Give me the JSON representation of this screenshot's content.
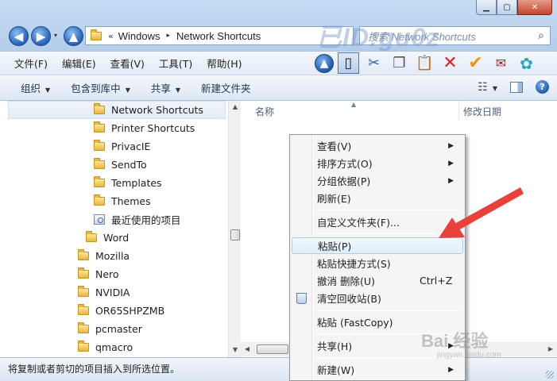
{
  "window": {
    "controls": {
      "minimize": "▁",
      "maximize": "▢",
      "close": "✕"
    }
  },
  "nav": {
    "back": "◀",
    "forward": "▶",
    "dropdown": "▾",
    "up": "▲"
  },
  "address": {
    "overflow": "«",
    "crumbs": [
      "Windows",
      "Network Shortcuts"
    ],
    "separator": "▸"
  },
  "search": {
    "placeholder": "搜索 Network Shortcuts",
    "icon": "search-icon"
  },
  "watermark_top": "已ID:gu0z",
  "menubar": {
    "items": [
      "文件(F)",
      "编辑(E)",
      "查看(V)",
      "工具(T)",
      "帮助(H)"
    ]
  },
  "toolbar_icons": {
    "up": "▲",
    "pane": "▯",
    "cut": "✂",
    "copy": "❐",
    "paste": "📋",
    "delete": "✕",
    "check": "✔",
    "props": "✉",
    "shell": "✿"
  },
  "cmdbar": {
    "items": [
      {
        "label": "组织",
        "caret": "▼"
      },
      {
        "label": "包含到库中",
        "caret": "▼"
      },
      {
        "label": "共享",
        "caret": "▼"
      },
      {
        "label": "新建文件夹",
        "caret": ""
      }
    ],
    "view_caret": "▼",
    "help": "?"
  },
  "tree": {
    "items": [
      {
        "label": "Network Shortcuts",
        "selected": true
      },
      {
        "label": "Printer Shortcuts"
      },
      {
        "label": "PrivacIE"
      },
      {
        "label": "SendTo"
      },
      {
        "label": "Templates"
      },
      {
        "label": "Themes"
      },
      {
        "label": "最近使用的项目",
        "icon": "recent-items-icon"
      },
      {
        "label": "Word"
      },
      {
        "label": "Mozilla"
      },
      {
        "label": "Nero"
      },
      {
        "label": "NVIDIA"
      },
      {
        "label": "OR65SHPZMB"
      },
      {
        "label": "pcmaster"
      },
      {
        "label": "qmacro"
      }
    ]
  },
  "columns": {
    "name": "名称",
    "modified": "修改日期",
    "sort_indicator": "▲"
  },
  "context_menu": {
    "items": [
      {
        "label": "查看(V)",
        "submenu": "▶"
      },
      {
        "label": "排序方式(O)",
        "submenu": "▶"
      },
      {
        "label": "分组依据(P)",
        "submenu": "▶"
      },
      {
        "label": "刷新(E)"
      },
      {
        "label": "自定义文件夹(F)..."
      },
      {
        "label": "粘贴(P)",
        "highlighted": true
      },
      {
        "label": "粘贴快捷方式(S)"
      },
      {
        "label": "撤消 删除(U)",
        "shortcut": "Ctrl+Z"
      },
      {
        "label": "清空回收站(B)",
        "icon": "recycle-bin-icon"
      },
      {
        "label": "粘贴 (FastCopy)"
      },
      {
        "label": "共享(H)",
        "submenu": "▶"
      },
      {
        "label": "新建(W)",
        "submenu": "▶"
      }
    ]
  },
  "status": {
    "text": "将复制或者剪切的项目插入到所选位置。"
  },
  "watermark_bottom": {
    "main": "Bai 经验",
    "sub": "jingyan.baidu.com"
  },
  "colors": {
    "arrow": "#e8413a",
    "selection": "#aeccf1",
    "accent": "#2361b8"
  }
}
